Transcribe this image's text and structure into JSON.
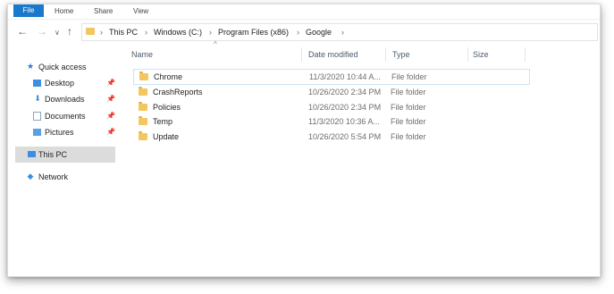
{
  "ribbon": {
    "tabs": [
      "File",
      "Home",
      "Share",
      "View"
    ]
  },
  "address": {
    "crumbs": [
      "This PC",
      "Windows (C:)",
      "Program Files (x86)",
      "Google"
    ]
  },
  "sidebar": {
    "quick_access": "Quick access",
    "items": [
      {
        "label": "Desktop"
      },
      {
        "label": "Downloads"
      },
      {
        "label": "Documents"
      },
      {
        "label": "Pictures"
      }
    ],
    "this_pc": "This PC",
    "network": "Network"
  },
  "columns": {
    "name": "Name",
    "date": "Date modified",
    "type": "Type",
    "size": "Size"
  },
  "files": [
    {
      "name": "Chrome",
      "date": "11/3/2020 10:44 A...",
      "type": "File folder",
      "selected": true
    },
    {
      "name": "CrashReports",
      "date": "10/26/2020 2:34 PM",
      "type": "File folder"
    },
    {
      "name": "Policies",
      "date": "10/26/2020 2:34 PM",
      "type": "File folder"
    },
    {
      "name": "Temp",
      "date": "11/3/2020 10:36 A...",
      "type": "File folder"
    },
    {
      "name": "Update",
      "date": "10/26/2020 5:54 PM",
      "type": "File folder"
    }
  ],
  "colors": {
    "accent": "#1979ca",
    "folder": "#f2c660",
    "selection_border": "#cce4f7",
    "sidebar_active": "#dcdcdc"
  },
  "icons": {
    "back": "arrow-left-icon",
    "forward": "arrow-right-icon",
    "recent": "chevron-down-icon",
    "up": "arrow-up-icon",
    "folder": "folder-icon",
    "quick_access": "star-icon",
    "pin": "pin-icon",
    "this_pc": "computer-icon",
    "network": "network-icon"
  }
}
